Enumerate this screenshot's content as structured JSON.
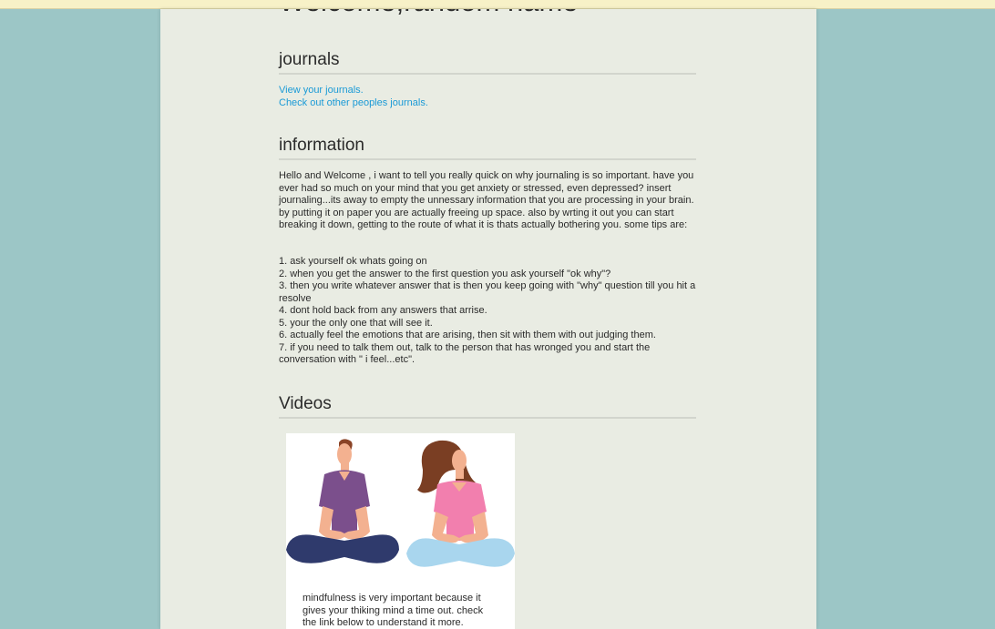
{
  "header": {
    "welcome": "Welcome,random name"
  },
  "journals": {
    "title": "journals",
    "links": [
      "View your journals.",
      "Check out other peoples journals."
    ]
  },
  "information": {
    "title": "information",
    "paragraph": "Hello and Welcome , i want to tell you really quick on why journaling is so important. have you ever had so much on your mind that you get anxiety or stressed, even depressed? insert journaling...its away to empty the unnessary information that you are processing in your brain. by putting it on paper you are actually freeing up space. also by wrting it out you can start breaking it down, getting to the route of what it is thats actually bothering you. some tips are:",
    "tips": [
      "1. ask yourself ok whats going on",
      "2. when you get the answer to the first question you ask yourself \"ok why\"?",
      "3. then you write whatever answer that is then you keep going with \"why\" question till you hit a resolve",
      "4. dont hold back from any answers that arrise.",
      "5. your the only one that will see it.",
      "6. actually feel the emotions that are arising, then sit with them with out judging them.",
      "7. if you need to talk them out, talk to the person that has wronged you and start the conversation with \" i feel...etc\"."
    ]
  },
  "videos": {
    "title": "Videos",
    "card": {
      "image": "meditating-people-illustration",
      "text": "mindfulness is very important because it gives your thiking mind a time out. check the link below to understand it more."
    }
  },
  "colors": {
    "background": "#9cc6c6",
    "page": "#e9ece3",
    "link": "#1a9ad6",
    "top_bar": "#f7f1c7"
  }
}
